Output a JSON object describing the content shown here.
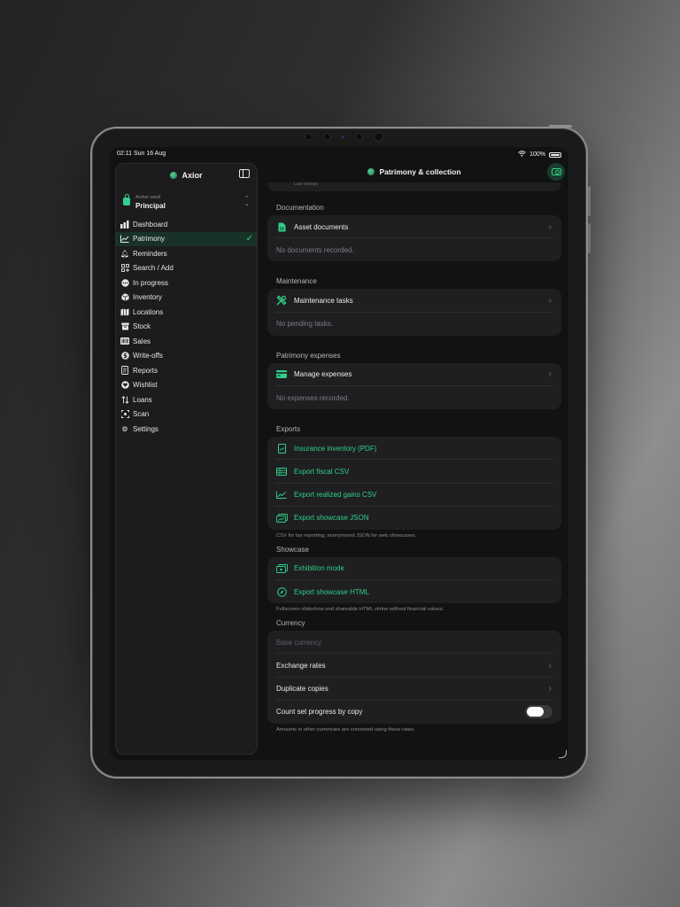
{
  "status": {
    "time": "02:11  Sun 16 Aug",
    "battery": "100%"
  },
  "sidebar": {
    "app_title": "Axior",
    "vault_caption": "Active vault",
    "vault_name": "Principal",
    "items": [
      {
        "label": "Dashboard",
        "icon": "chart-bar-icon"
      },
      {
        "label": "Patrimony",
        "icon": "chart-line-icon",
        "active": true
      },
      {
        "label": "Reminders",
        "icon": "bell-icon"
      },
      {
        "label": "Search / Add",
        "icon": "grid-plus-icon"
      },
      {
        "label": "In progress",
        "icon": "dots-circle-icon"
      },
      {
        "label": "Inventory",
        "icon": "cube-icon"
      },
      {
        "label": "Locations",
        "icon": "map-icon"
      },
      {
        "label": "Stock",
        "icon": "archive-box-icon"
      },
      {
        "label": "Sales",
        "icon": "barcode-icon"
      },
      {
        "label": "Write-offs",
        "icon": "dollar-circle-icon"
      },
      {
        "label": "Reports",
        "icon": "doc-text-icon"
      },
      {
        "label": "Wishlist",
        "icon": "heart-circle-icon"
      },
      {
        "label": "Loans",
        "icon": "arrows-swap-icon"
      },
      {
        "label": "Scan",
        "icon": "scan-icon"
      },
      {
        "label": "Settings",
        "icon": "gear-icon"
      }
    ]
  },
  "header": {
    "title": "Patrimony & collection"
  },
  "cut_text": "Last change",
  "sections": {
    "documentation": {
      "title": "Documentation",
      "row": "Asset documents",
      "empty": "No documents recorded."
    },
    "maintenance": {
      "title": "Maintenance",
      "row": "Maintenance tasks",
      "empty": "No pending tasks."
    },
    "expenses": {
      "title": "Patrimony expenses",
      "row": "Manage expenses",
      "empty": "No expenses recorded."
    },
    "exports": {
      "title": "Exports",
      "rows": [
        "Insurance inventory (PDF)",
        "Export fiscal CSV",
        "Export realized gains CSV",
        "Export showcase JSON"
      ],
      "footer": "CSV for tax reporting; anonymized JSON for web showcases."
    },
    "showcase": {
      "title": "Showcase",
      "rows": [
        "Exhibition mode",
        "Export showcase HTML"
      ],
      "footer": "Fullscreen slideshow and shareable HTML vitrine without financial values."
    },
    "currency": {
      "title": "Currency",
      "base_placeholder": "Base currency",
      "rows": [
        "Exchange rates",
        "Duplicate copies"
      ],
      "toggle_label": "Count set progress by copy",
      "toggle_on": false,
      "footer": "Amounts in other currencies are converted using these rates."
    }
  },
  "colors": {
    "accent": "#2fd08a",
    "background": "#121212",
    "card": "#1f1f21"
  }
}
